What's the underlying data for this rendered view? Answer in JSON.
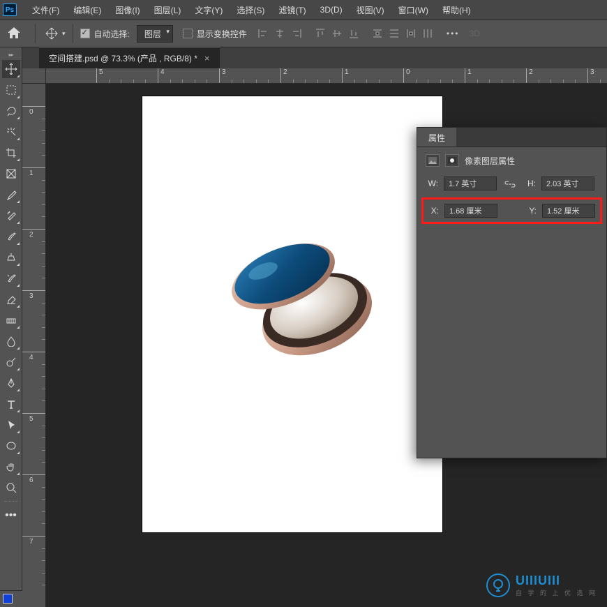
{
  "app": {
    "ps_label": "Ps"
  },
  "menu": [
    "文件(F)",
    "编辑(E)",
    "图像(I)",
    "图层(L)",
    "文字(Y)",
    "选择(S)",
    "滤镜(T)",
    "3D(D)",
    "视图(V)",
    "窗口(W)",
    "帮助(H)"
  ],
  "options": {
    "auto_select": "自动选择:",
    "target": "图层",
    "show_transform": "显示变换控件",
    "three_d": "3D"
  },
  "document_tab": {
    "title": "空间搭建.psd @ 73.3% (产品 , RGB/8) *"
  },
  "ruler_h_marks": [
    {
      "pos": 72,
      "label": "5"
    },
    {
      "pos": 160,
      "label": "4"
    },
    {
      "pos": 248,
      "label": "3"
    },
    {
      "pos": 336,
      "label": "2"
    },
    {
      "pos": 424,
      "label": "1"
    },
    {
      "pos": 512,
      "label": "0"
    },
    {
      "pos": 600,
      "label": "1"
    },
    {
      "pos": 688,
      "label": "2"
    },
    {
      "pos": 776,
      "label": "3"
    }
  ],
  "ruler_v_marks": [
    {
      "pos": 32,
      "label": "0"
    },
    {
      "pos": 120,
      "label": "1"
    },
    {
      "pos": 208,
      "label": "2"
    },
    {
      "pos": 296,
      "label": "3"
    },
    {
      "pos": 384,
      "label": "4"
    },
    {
      "pos": 472,
      "label": "5"
    },
    {
      "pos": 560,
      "label": "6"
    },
    {
      "pos": 648,
      "label": "7"
    }
  ],
  "panel": {
    "tab": "属性",
    "subtitle": "像素图层属性",
    "w_label": "W:",
    "h_label": "H:",
    "x_label": "X:",
    "y_label": "Y:",
    "w_value": "1.7 英寸",
    "h_value": "2.03 英寸",
    "x_value": "1.68 厘米",
    "y_value": "1.52 厘米"
  },
  "watermark": {
    "brand": "UIIIUIII",
    "sub": "自 学 的 上 优 选 网"
  }
}
